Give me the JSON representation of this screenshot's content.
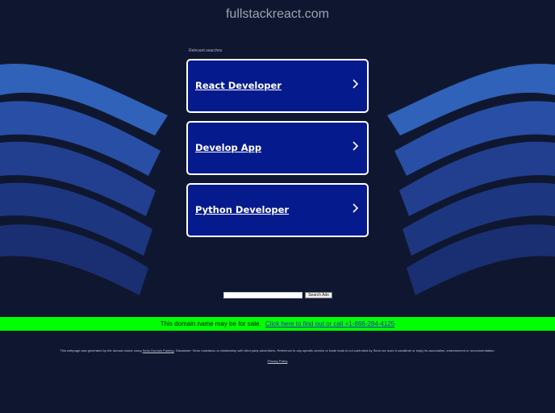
{
  "site": {
    "title": "fullstackreact.com"
  },
  "related": {
    "label": "Relevant searches",
    "items": [
      {
        "label": "React Developer"
      },
      {
        "label": "Develop App"
      },
      {
        "label": "Python Developer"
      }
    ]
  },
  "search": {
    "placeholder": "",
    "button_label": "Search Ads"
  },
  "sale_banner": {
    "text": "This domain name may be for sale.",
    "link_text": "Click here to find out or call +1-866-284-4125"
  },
  "footer": {
    "disclaimer_prefix": "This webpage was generated by the domain owner using",
    "parking_link": "Sedo Domain Parking",
    "disclaimer_suffix": ". Disclaimer: Sedo maintains no relationship with third party advertisers. Reference to any specific service or trade mark is not controlled by Sedo nor does it constitute or imply its association, endorsement or recommendation.",
    "privacy_link": "Privacy Policy"
  },
  "colors": {
    "background": "#0f1730",
    "card_fill": "#051a8c",
    "card_border": "#ffffff",
    "sale_bar": "#00ff00",
    "wave_light": "#2c5aa8",
    "wave_dark": "#1b3575"
  },
  "icons": {
    "card_arrow": "chevron-right-icon"
  }
}
